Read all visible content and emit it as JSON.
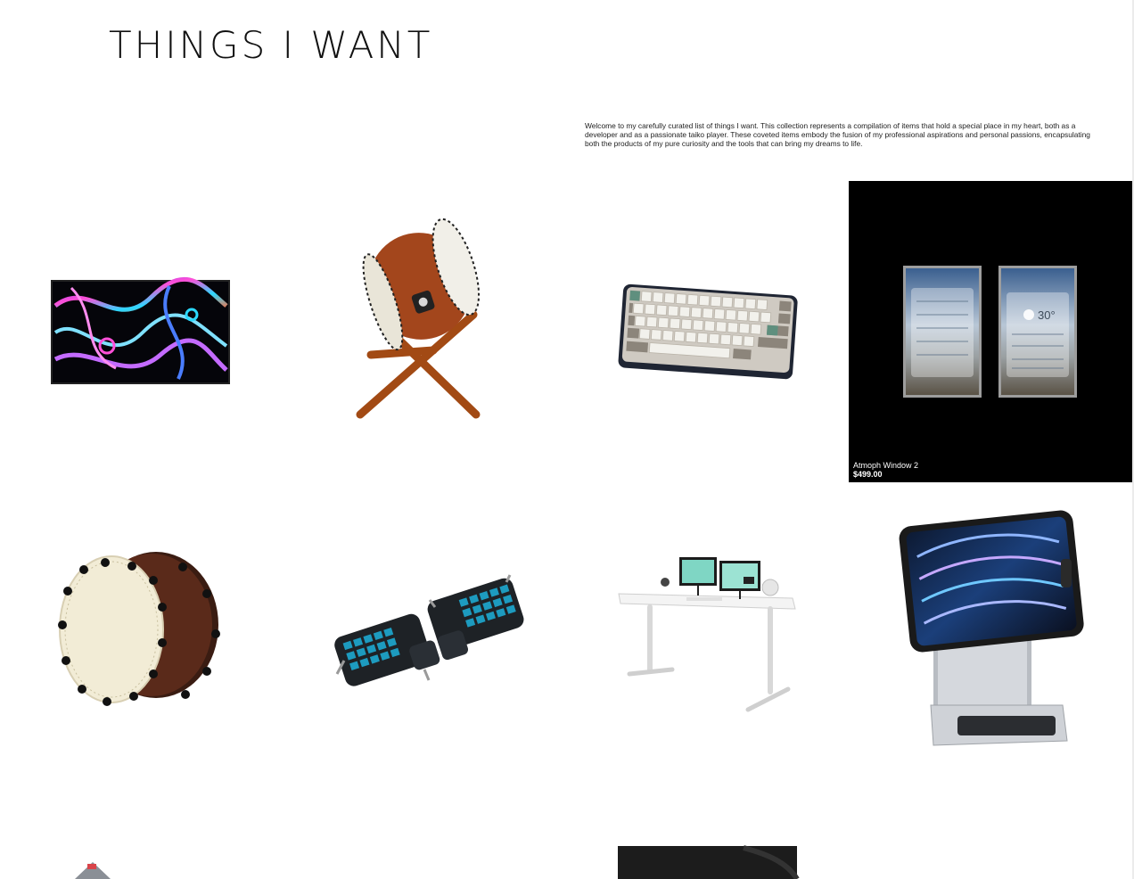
{
  "page": {
    "title": "THINGS I WANT",
    "intro": "Welcome to my carefully curated list of things I want. This collection represents a compilation of items that hold a special place in my heart, both as a developer and as a passionate taiko player. These coveted items embody the fusion of my professional aspirations and personal passions, encapsulating both the products of my pure curiosity and the tools that can bring my dreams to life."
  },
  "products": [
    {
      "id": "monitor",
      "icon": "monitor-with-swirl-art"
    },
    {
      "id": "taiko-stand",
      "icon": "taiko-drum-on-stand"
    },
    {
      "id": "keyboard",
      "icon": "compact-mechanical-keyboard"
    },
    {
      "id": "atmoph",
      "icon": "atmoph-window-displays",
      "name": "Atmoph Window 2",
      "price": "$499.00",
      "weather": "30°"
    },
    {
      "id": "taiko-drum",
      "icon": "taiko-drum"
    },
    {
      "id": "split-keyboard",
      "icon": "split-ergonomic-keyboard"
    },
    {
      "id": "standing-desk",
      "icon": "standing-desk-setup"
    },
    {
      "id": "ipad-stand",
      "icon": "ipad-on-stand"
    },
    {
      "id": "partial-device",
      "icon": "partial-device"
    },
    {
      "id": "partial-dark",
      "icon": "partial-dark-product"
    }
  ]
}
